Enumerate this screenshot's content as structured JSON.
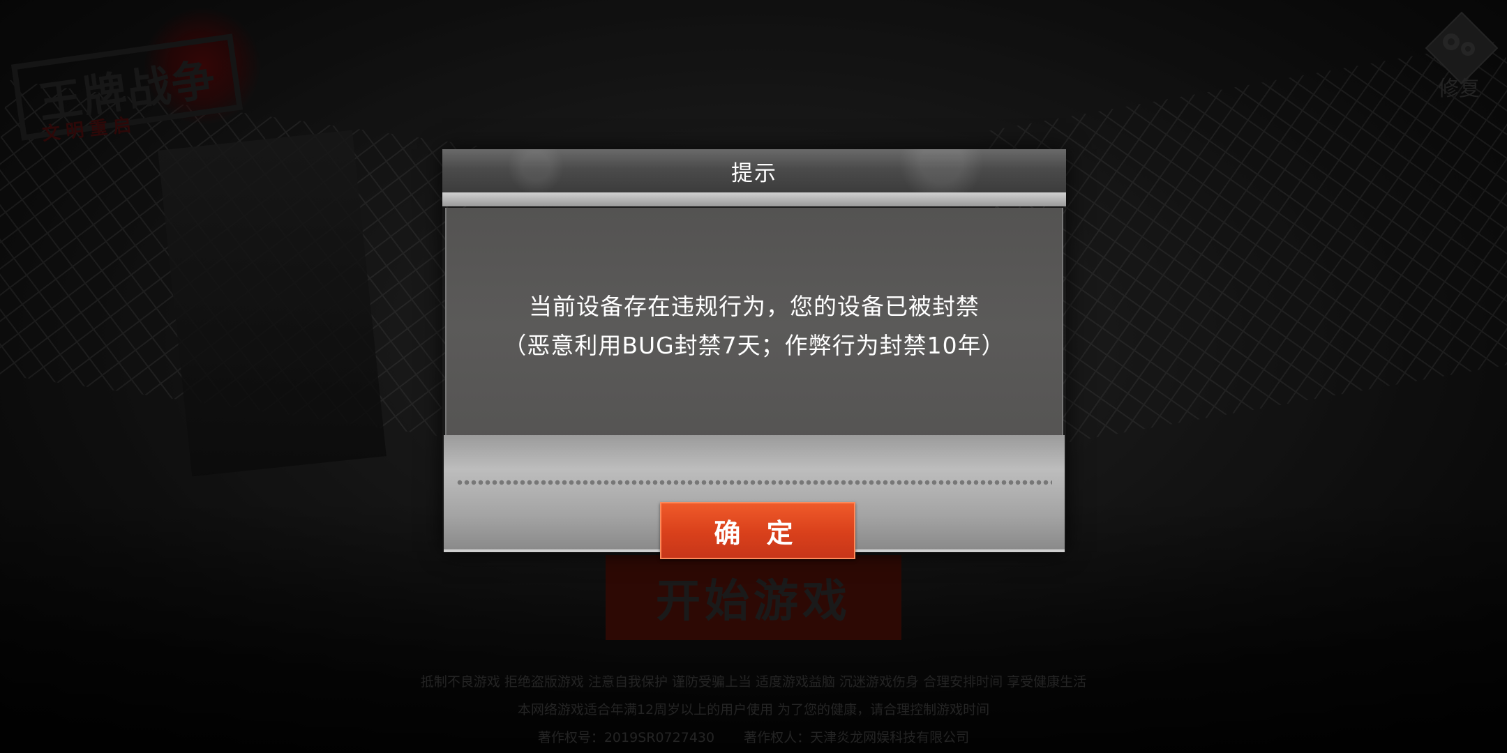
{
  "logo": {
    "title": "王牌战争",
    "subtitle": "文明重启"
  },
  "repair": {
    "label": "修复",
    "icon": "gear-icon"
  },
  "start_button": {
    "label": "开始游戏"
  },
  "dialog": {
    "title": "提示",
    "message_line1": "当前设备存在违规行为，您的设备已被封禁",
    "message_line2": "（恶意利用BUG封禁7天；作弊行为封禁10年）",
    "confirm_label": "确 定"
  },
  "footer": {
    "line1": "抵制不良游戏 拒绝盗版游戏 注意自我保护 谨防受骗上当 适度游戏益脑 沉迷游戏伤身 合理安排时间 享受健康生活",
    "line2": "本网络游戏适合年满12周岁以上的用户使用   为了您的健康，请合理控制游戏时间",
    "copyright_no": "著作权号：2019SR0727430",
    "copyright_owner": "著作权人：天津炎龙网娱科技有限公司"
  },
  "colors": {
    "accent": "#d9401b",
    "dialog_body": "#575655",
    "start_button_bg": "#4a0f08"
  }
}
